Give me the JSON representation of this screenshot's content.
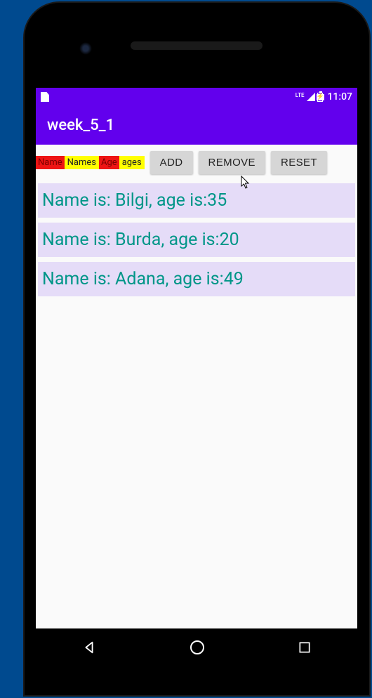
{
  "statusbar": {
    "lte": "LTE",
    "clock": "11:07"
  },
  "appbar": {
    "title": "week_5_1"
  },
  "controls": {
    "name_label": "Name",
    "name_value": "Names",
    "age_label": "Age",
    "age_value": "ages",
    "add_label": "ADD",
    "remove_label": "REMOVE",
    "reset_label": "RESET"
  },
  "list": {
    "items": [
      {
        "text": "Name is: Bilgi, age is:35"
      },
      {
        "text": "Name is: Burda, age is:20"
      },
      {
        "text": "Name is: Adana, age is:49"
      }
    ]
  }
}
